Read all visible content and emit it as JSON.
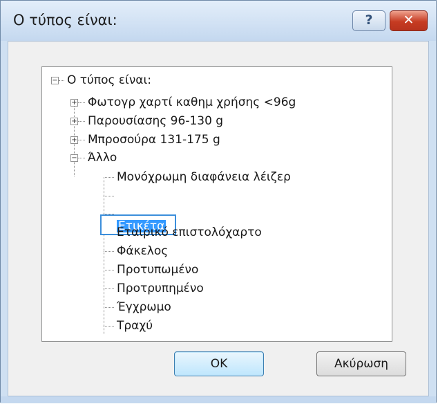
{
  "window": {
    "title": "Ο τύπος είναι:",
    "help_label": "?",
    "close_label": "✕"
  },
  "tree": {
    "root": "Ο τύπος είναι:",
    "categories": [
      "Φωτογρ χαρτί καθημ χρήσης <96g",
      "Παρουσίασης 96-130 g",
      "Μπροσούρα 131-175 g",
      "Άλλο"
    ],
    "other_items": [
      "Μονόχρωμη διαφάνεια λέιζερ",
      "Ετικέτα",
      "Εταιρικό επιστολόχαρτο",
      "Φάκελος",
      "Προτυπωμένο",
      "Προτρυπημένο",
      "Έγχρωμο",
      "Τραχύ"
    ],
    "selected_item": "Ετικέτα"
  },
  "buttons": {
    "ok": "OK",
    "cancel": "Ακύρωση"
  }
}
